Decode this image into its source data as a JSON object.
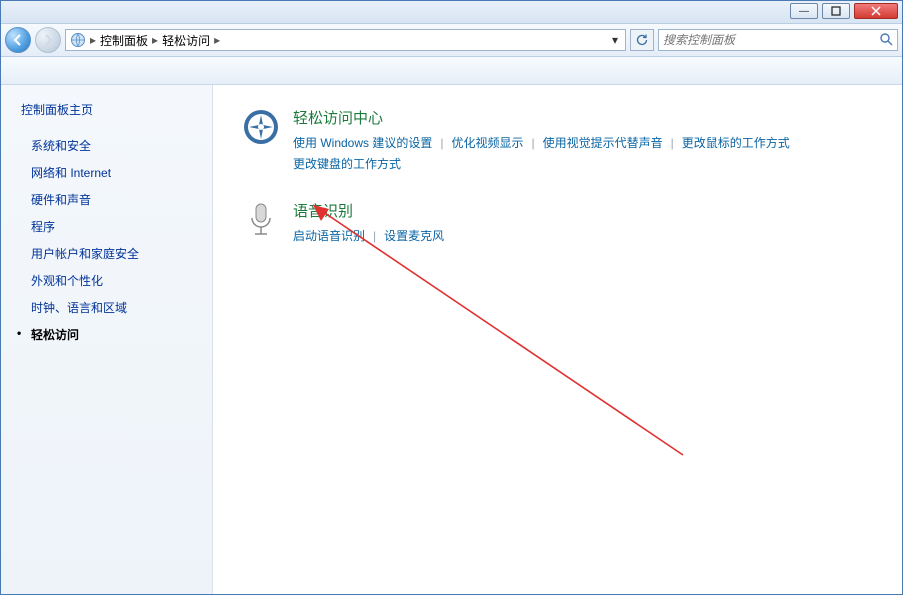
{
  "window": {
    "minimize": "—",
    "maximize": "▢",
    "close": "✕"
  },
  "breadcrumb": {
    "item1": "控制面板",
    "item2": "轻松访问"
  },
  "search": {
    "placeholder": "搜索控制面板"
  },
  "sidebar": {
    "title": "控制面板主页",
    "items": [
      {
        "label": "系统和安全"
      },
      {
        "label": "网络和 Internet"
      },
      {
        "label": "硬件和声音"
      },
      {
        "label": "程序"
      },
      {
        "label": "用户帐户和家庭安全"
      },
      {
        "label": "外观和个性化"
      },
      {
        "label": "时钟、语言和区域"
      },
      {
        "label": "轻松访问",
        "current": true
      }
    ]
  },
  "sections": {
    "ease": {
      "title": "轻松访问中心",
      "links": [
        "使用 Windows 建议的设置",
        "优化视频显示",
        "使用视觉提示代替声音",
        "更改鼠标的工作方式",
        "更改键盘的工作方式"
      ]
    },
    "speech": {
      "title": "语音识别",
      "links": [
        "启动语音识别",
        "设置麦克风"
      ]
    }
  }
}
